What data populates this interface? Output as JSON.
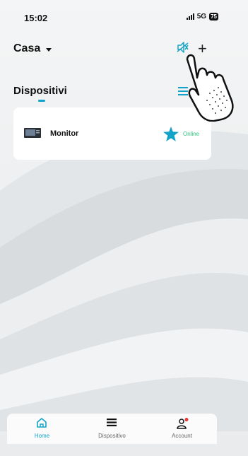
{
  "status_bar": {
    "time": "15:02",
    "network": "5G",
    "battery": "75"
  },
  "header": {
    "home_name": "Casa",
    "add_label": "+"
  },
  "section": {
    "title": "Dispositivi"
  },
  "devices": [
    {
      "name": "Monitor",
      "status": "Online"
    }
  ],
  "tabbar": {
    "items": [
      {
        "label": "Home",
        "icon": "home-icon"
      },
      {
        "label": "Dispositivo",
        "icon": "device-list-icon"
      },
      {
        "label": "Account",
        "icon": "user-icon"
      }
    ]
  },
  "colors": {
    "accent": "#13a3c8",
    "online": "#2bc47a",
    "notification": "#e53935"
  }
}
